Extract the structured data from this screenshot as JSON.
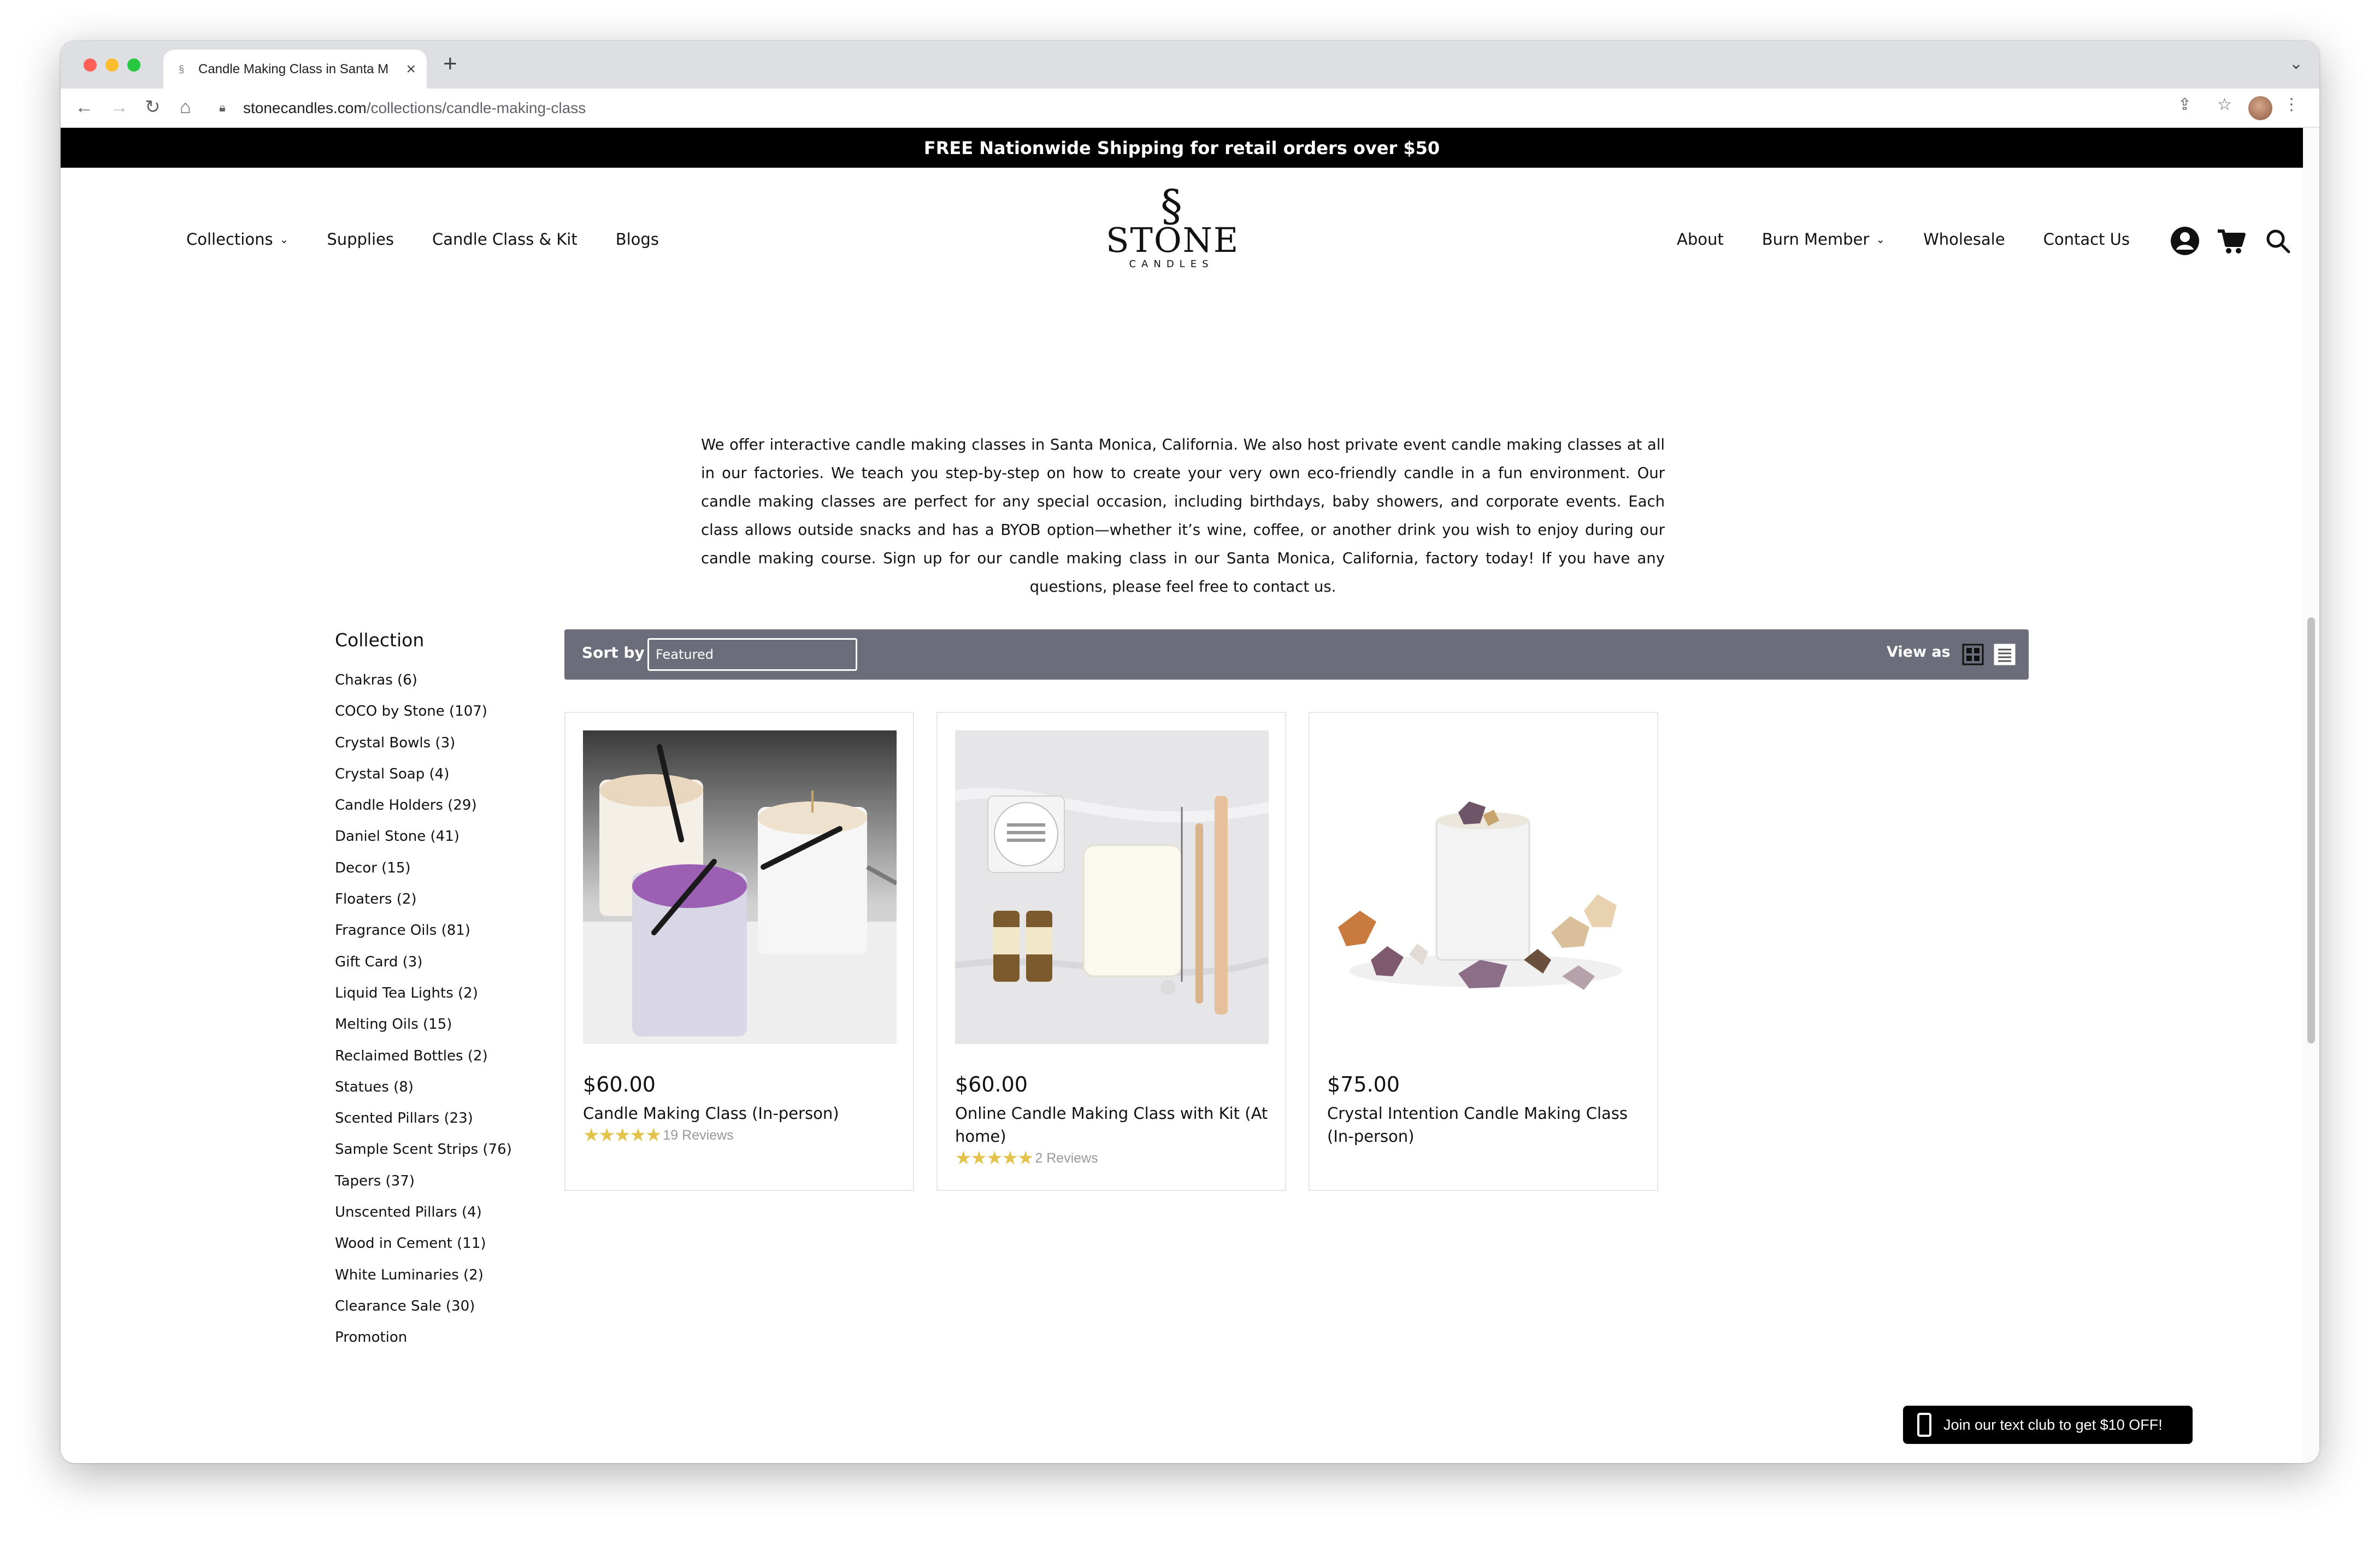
{
  "browser": {
    "tab_title": "Candle Making Class in Santa M",
    "url_host": "stonecandles.com",
    "url_path": "/collections/candle-making-class"
  },
  "announcement": "FREE Nationwide Shipping for retail orders over $50",
  "header": {
    "nav_left": [
      "Collections",
      "Supplies",
      "Candle Class & Kit",
      "Blogs"
    ],
    "nav_right": [
      "About",
      "Burn Member",
      "Wholesale",
      "Contact Us"
    ],
    "logo_main": "STONE",
    "logo_sub": "CANDLES"
  },
  "intro_text": "We offer interactive candle making classes in Santa Monica, California. We also host private event candle making classes at all in our factories. We teach you step-by-step on how to create your very own eco-friendly candle in a fun environment. Our candle making classes are perfect for any special occasion, including birthdays, baby showers, and corporate events. Each class allows outside snacks and has a BYOB option—whether it’s wine, coffee, or another drink you wish to enjoy during our candle making course. Sign up for our candle making class in our Santa Monica, California, factory today! If you have any questions, please feel free to contact us.",
  "sidebar": {
    "title": "Collection",
    "items": [
      "Chakras (6)",
      "COCO by Stone (107)",
      "Crystal Bowls (3)",
      "Crystal Soap (4)",
      "Candle Holders (29)",
      "Daniel Stone (41)",
      "Decor (15)",
      "Floaters (2)",
      "Fragrance Oils (81)",
      "Gift Card (3)",
      "Liquid Tea Lights (2)",
      "Melting Oils (15)",
      "Reclaimed Bottles (2)",
      "Statues (8)",
      "Scented Pillars (23)",
      "Sample Scent Strips (76)",
      "Tapers (37)",
      "Unscented Pillars (4)",
      "Wood in Cement (11)",
      "White Luminaries (2)",
      "Clearance Sale (30)",
      "Promotion"
    ]
  },
  "sortbar": {
    "sort_label": "Sort by",
    "sort_value": "Featured",
    "view_label": "View as"
  },
  "products": [
    {
      "price": "$60.00",
      "title": "Candle Making Class (In-person)",
      "reviews": "19 Reviews",
      "rating": 5
    },
    {
      "price": "$60.00",
      "title": "Online Candle Making Class with Kit (At home)",
      "reviews": "2 Reviews",
      "rating": 5
    },
    {
      "price": "$75.00",
      "title": "Crystal Intention Candle Making Class (In-person)"
    }
  ],
  "text_club": "Join our text club to get $10 OFF!",
  "colors": {
    "announcement_bg": "#000000",
    "sortbar_bg": "#6b6e7a",
    "star": "#e3c34b"
  }
}
